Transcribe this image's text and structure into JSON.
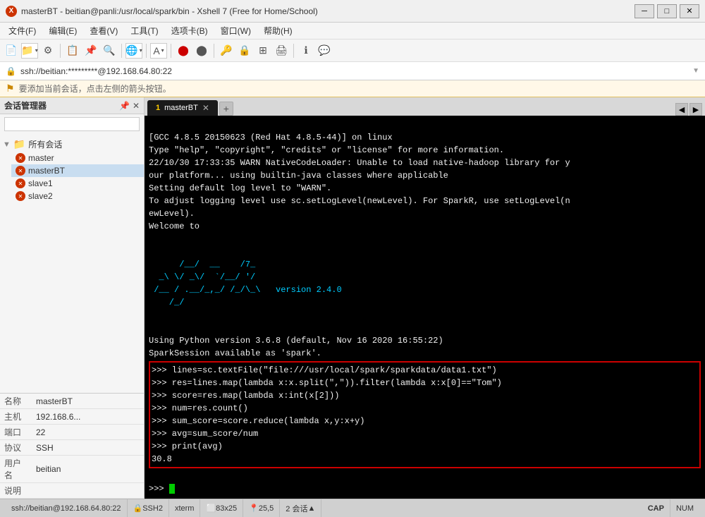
{
  "titleBar": {
    "title": "masterBT - beitian@panli:/usr/local/spark/bin - Xshell 7 (Free for Home/School)",
    "appIcon": "X",
    "controls": {
      "minimize": "─",
      "maximize": "□",
      "close": "✕"
    }
  },
  "menuBar": {
    "items": [
      "文件(F)",
      "编辑(E)",
      "查看(V)",
      "工具(T)",
      "选项卡(B)",
      "窗口(W)",
      "帮助(H)"
    ]
  },
  "addressBar": {
    "icon": "🔒",
    "text": "ssh://beitian:*********@192.168.64.80:22",
    "arrow": "▼"
  },
  "infoBar": {
    "icon": "⚑",
    "text": "要添加当前会话，点击左侧的箭头按钮。"
  },
  "sidebar": {
    "title": "会话管理器",
    "searchPlaceholder": "",
    "treeRoot": {
      "label": "所有会话",
      "children": [
        "master",
        "masterBT",
        "slave1",
        "slave2"
      ]
    },
    "infoPanel": {
      "rows": [
        {
          "label": "名称",
          "value": "masterBT"
        },
        {
          "label": "主机",
          "value": "192.168.6..."
        },
        {
          "label": "端口",
          "value": "22"
        },
        {
          "label": "协议",
          "value": "SSH"
        },
        {
          "label": "用户名",
          "value": "beitian"
        },
        {
          "label": "说明",
          "value": ""
        }
      ]
    }
  },
  "tabs": {
    "items": [
      {
        "num": "1",
        "label": "masterBT"
      }
    ],
    "addLabel": "+",
    "navPrev": "◀",
    "navNext": "▶"
  },
  "terminal": {
    "lines": [
      "[GCC 4.8.5 20150623 (Red Hat 4.8.5-44)] on linux",
      "Type \"help\", \"copyright\", \"credits\" or \"license\" for more information.",
      "22/10/30 17:33:35 WARN NativeCodeLoader: Unable to load native-hadoop library for y",
      "our platform... using builtin-java classes where applicable",
      "Setting default log level to \"WARN\".",
      "To adjust logging level use sc.setLogLevel(newLevel). For SparkR, use setLogLevel(n",
      "ewLevel).",
      "Welcome to"
    ],
    "sparkArt": [
      "      /__/  __    /7_",
      "  _\\ \\/ _\\/  `/__/ '/",
      " /__ / .__/_,_/ /_/\\_\\   version 2.4.0",
      "    /_/"
    ],
    "afterArt": [
      "",
      "Using Python version 3.6.8 (default, Nov 16 2020 16:55:22)",
      "SparkSession available as 'spark'."
    ],
    "commandBlock": [
      ">>> lines=sc.textFile(\"file:///usr/local/spark/sparkdata/data1.txt\")",
      ">>> res=lines.map(lambda x:x.split(\",\")).filter(lambda x:x[0]==\"Tom\")",
      ">>> score=res.map(lambda x:int(x[2]))",
      ">>> num=res.count()",
      ">>> sum_score=score.reduce(lambda x,y:x+y)",
      ">>> avg=sum_score/num",
      ">>> print(avg)",
      "30.8"
    ]
  },
  "statusBar": {
    "sshText": "ssh://beitian@192.168.64.80:22",
    "protocol": "SSH2",
    "terminal": "xterm",
    "dimensions": "83x25",
    "position": "25,5",
    "sessions": "2 会话",
    "arrowUp": "▲",
    "capLabel": "CAP",
    "numLabel": "NUM"
  }
}
